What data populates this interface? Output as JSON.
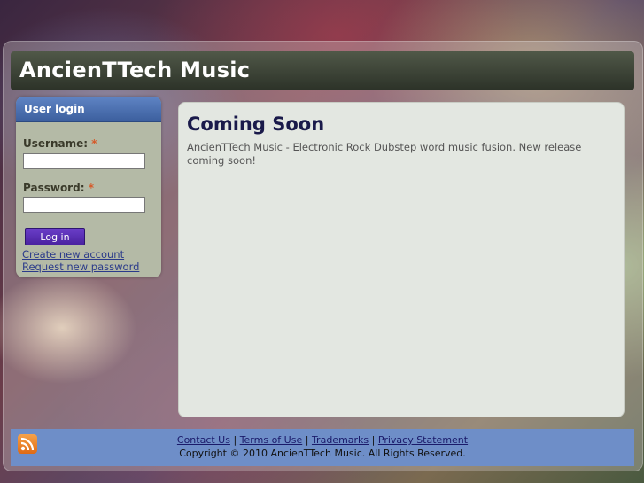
{
  "site": {
    "title": "AncienTTech Music"
  },
  "login": {
    "heading": "User login",
    "username_label": "Username:",
    "password_label": "Password:",
    "required_mark": "*",
    "button": "Log in",
    "create_account": "Create new account",
    "request_password": "Request new password"
  },
  "content": {
    "title": "Coming Soon",
    "body": "AncienTTech Music - Electronic Rock Dubstep word music fusion. New release coming soon!"
  },
  "footer": {
    "links": [
      "Contact Us",
      "Terms of Use",
      "Trademarks",
      "Privacy Statement"
    ],
    "separator": "|",
    "copyright": "Copyright © 2010 AncienTTech Music. All Rights Reserved."
  },
  "icons": {
    "feed": "rss-icon"
  },
  "colors": {
    "header": "#2c3228",
    "sidebar_head": "#4a6db0",
    "button": "#5a30b8",
    "footer": "#6e8ec8",
    "content_bg": "#e3e7e1"
  }
}
